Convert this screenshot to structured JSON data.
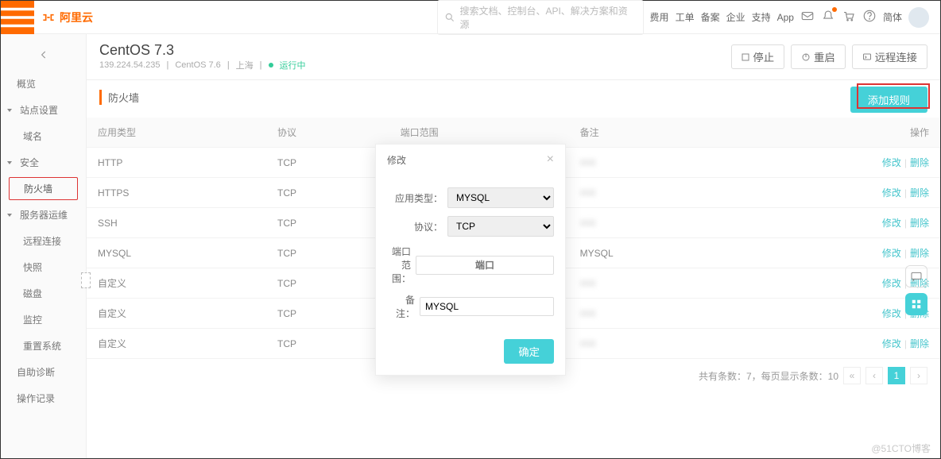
{
  "topbar": {
    "logoText": "阿里云",
    "searchPlaceholder": "搜索文档、控制台、API、解决方案和资源",
    "links": [
      "费用",
      "工单",
      "备案",
      "企业",
      "支持",
      "App"
    ],
    "langLabel": "简体"
  },
  "sidebar": {
    "items": [
      {
        "label": "概览",
        "type": "item"
      },
      {
        "label": "站点设置",
        "type": "parent"
      },
      {
        "label": "域名",
        "type": "child"
      },
      {
        "label": "安全",
        "type": "parent"
      },
      {
        "label": "防火墙",
        "type": "active"
      },
      {
        "label": "服务器运维",
        "type": "parent"
      },
      {
        "label": "远程连接",
        "type": "child"
      },
      {
        "label": "快照",
        "type": "child"
      },
      {
        "label": "磁盘",
        "type": "child"
      },
      {
        "label": "监控",
        "type": "child"
      },
      {
        "label": "重置系统",
        "type": "child"
      },
      {
        "label": "自助诊断",
        "type": "item"
      },
      {
        "label": "操作记录",
        "type": "item"
      }
    ]
  },
  "header": {
    "title": "CentOS 7.3",
    "ip": "139.224.54.235",
    "os": "CentOS 7.6",
    "region": "上海",
    "status": "运行中",
    "btnStop": "停止",
    "btnRestart": "重启",
    "btnRemote": "远程连接"
  },
  "firewall": {
    "sectionTitle": "防火墙",
    "addBtn": "添加规则",
    "columns": [
      "应用类型",
      "协议",
      "端口范围",
      "备注",
      "操作"
    ],
    "rows": [
      {
        "type": "HTTP",
        "proto": "TCP",
        "port": "",
        "note": ""
      },
      {
        "type": "HTTPS",
        "proto": "TCP",
        "port": "",
        "note": ""
      },
      {
        "type": "SSH",
        "proto": "TCP",
        "port": "",
        "note": ""
      },
      {
        "type": "MYSQL",
        "proto": "TCP",
        "port": "",
        "note": "MYSQL"
      },
      {
        "type": "自定义",
        "proto": "TCP",
        "port": "",
        "note": ""
      },
      {
        "type": "自定义",
        "proto": "TCP",
        "port": "",
        "note": ""
      },
      {
        "type": "自定义",
        "proto": "TCP",
        "port": "",
        "note": ""
      }
    ],
    "actionEdit": "修改",
    "actionDelete": "删除",
    "pagi": {
      "total": "共有条数：7，每页显示条数：10",
      "current": "1"
    }
  },
  "modal": {
    "title": "修改",
    "fields": {
      "typeLabel": "应用类型：",
      "typeValue": "MYSQL",
      "protoLabel": "协议：",
      "protoValue": "TCP",
      "portLabel": "端口范围：",
      "portPlaceholder": "端口",
      "noteLabel": "备注：",
      "noteValue": "MYSQL"
    },
    "ok": "确定"
  },
  "watermark": "@51CTO博客"
}
